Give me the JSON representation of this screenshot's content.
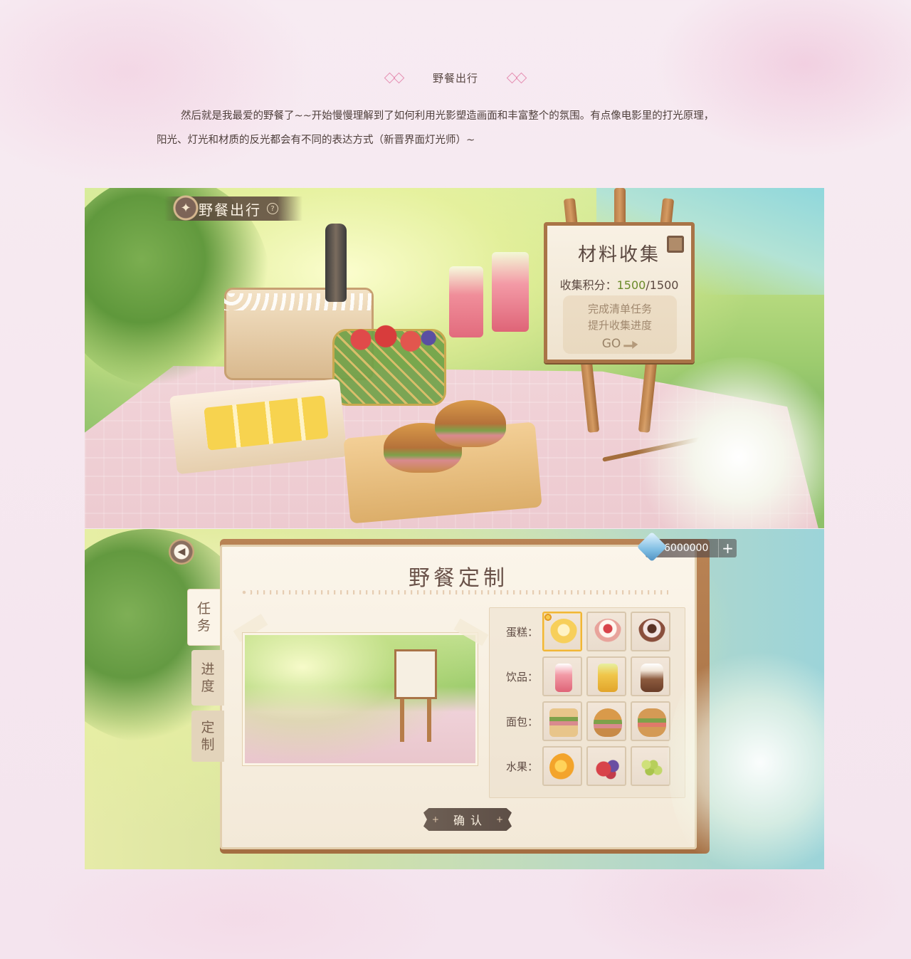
{
  "header": {
    "section_title": "野餐出行",
    "intro_line1": "然后就是我最爱的野餐了~~开始慢慢理解到了如何利用光影塑造画面和丰富整个的氛围。有点像电影里的打光原理，",
    "intro_line2": "阳光、灯光和材质的反光都会有不同的表达方式（新晋界面灯光师）~"
  },
  "picnic_screen": {
    "title": "野餐出行",
    "help_icon": "question-icon",
    "easel": {
      "title": "材料收集",
      "score_label": "收集积分：",
      "score_current": "1500",
      "score_sep": "/",
      "score_total": "1500",
      "task_line1": "完成清单任务",
      "task_line2": "提升收集进度",
      "go_label": "GO"
    }
  },
  "custom_screen": {
    "title": "野餐定制",
    "currency_value": "6000000",
    "currency_plus": "+",
    "tabs": [
      {
        "label_top": "任",
        "label_bottom": "务"
      },
      {
        "label_top": "进",
        "label_bottom": "度"
      },
      {
        "label_top": "定",
        "label_bottom": "制"
      }
    ],
    "categories": [
      {
        "label": "蛋糕：",
        "items": [
          "orange-cake",
          "strawberry-cream-cake",
          "chocolate-cupcake"
        ],
        "colors": [
          "#f7cf5a",
          "#e8a39b",
          "#8a4f3c"
        ],
        "selected": 0
      },
      {
        "label": "饮品：",
        "items": [
          "strawberry-soda",
          "lemon-tea",
          "cocoa-latte"
        ],
        "colors": [
          "#f29aa6",
          "#f0c64a",
          "#8c5a3e"
        ],
        "selected": -1
      },
      {
        "label": "面包：",
        "items": [
          "club-sandwich",
          "croissant-sandwich",
          "sub-sandwich"
        ],
        "colors": [
          "#d9a45a",
          "#c98a4b",
          "#d49a55"
        ],
        "selected": -1
      },
      {
        "label": "水果：",
        "items": [
          "oranges",
          "berries",
          "grapes"
        ],
        "colors": [
          "#f3a42b",
          "#d8434a",
          "#b7cf5b"
        ],
        "selected": -1
      }
    ],
    "confirm_label": "确认"
  }
}
